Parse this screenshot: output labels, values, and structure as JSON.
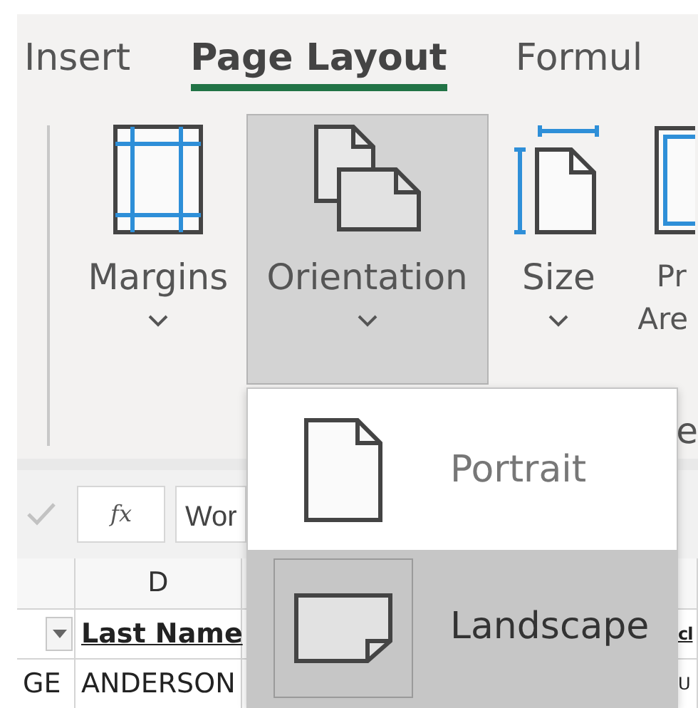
{
  "tabs": [
    {
      "label": "Insert",
      "selected": false
    },
    {
      "label": "Page Layout",
      "selected": true
    },
    {
      "label": "Formul",
      "selected": false
    }
  ],
  "ribbon_buttons": [
    {
      "kind": "margins",
      "lines": [
        "Margins"
      ],
      "pressed": false
    },
    {
      "kind": "orientation",
      "lines": [
        "Orientation"
      ],
      "pressed": true
    },
    {
      "kind": "size",
      "lines": [
        "Size"
      ],
      "pressed": false
    },
    {
      "kind": "print_area",
      "lines": [
        "Pr",
        "Are"
      ],
      "pressed": false
    }
  ],
  "ribbon_fragment": "e",
  "orientation_menu": {
    "items": [
      {
        "kind": "portrait",
        "label": "Portrait",
        "selected": false
      },
      {
        "kind": "landscape",
        "label": "Landscape",
        "selected": true
      }
    ]
  },
  "formula_bar": {
    "function_label": "fx",
    "formula": "Wor"
  },
  "sheet": {
    "columns": [
      "",
      "D",
      "",
      ""
    ],
    "rows": [
      {
        "kind": "header",
        "cells": [
          "",
          "Last Name",
          "",
          "cl"
        ]
      },
      {
        "kind": "data",
        "cells": [
          "GE",
          "ANDERSON",
          "",
          "U"
        ]
      }
    ]
  }
}
